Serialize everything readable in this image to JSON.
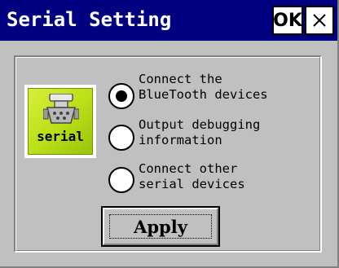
{
  "window": {
    "title": "Serial Setting",
    "ok_label": "OK",
    "close_icon": "close-icon"
  },
  "colors": {
    "titlebar": "#000080",
    "title_text": "#ffffff",
    "window_bg": "#c0c0c0",
    "icon_green": "#b9de16"
  },
  "icon": {
    "name": "serial-port-icon",
    "label": "serial"
  },
  "options": [
    {
      "line1": "Connect the",
      "line2": "BlueTooth devices",
      "selected": true
    },
    {
      "line1": "Output debugging",
      "line2": "information",
      "selected": false
    },
    {
      "line1": "Connect other",
      "line2": "serial devices",
      "selected": false
    }
  ],
  "apply_label": "Apply"
}
